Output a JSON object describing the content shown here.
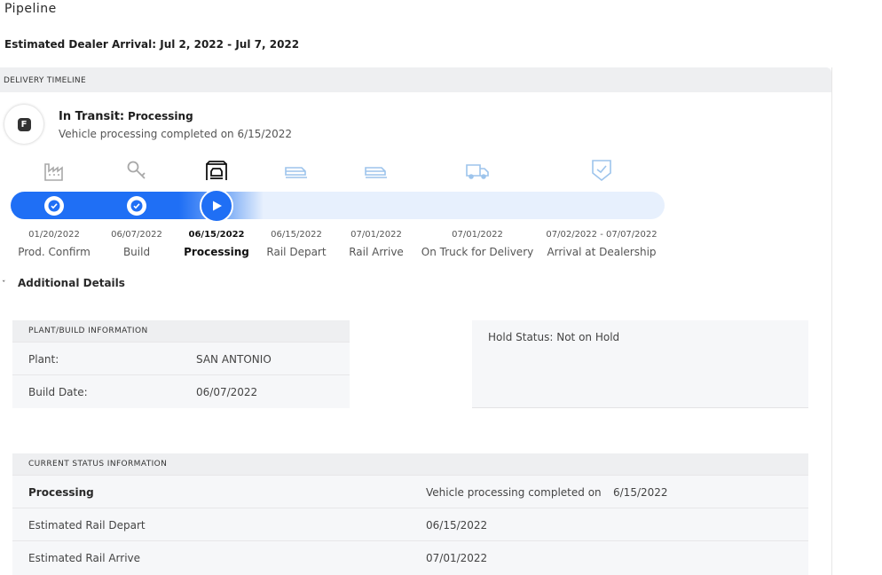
{
  "page": {
    "title": "Pipeline",
    "arrival": "Estimated Dealer Arrival: Jul 2, 2022 - Jul 7, 2022"
  },
  "timeline": {
    "header": "DELIVERY TIMELINE",
    "status_badge": "F",
    "status_label": "In Transit:",
    "status_value": "Processing",
    "status_sub": "Vehicle processing completed on 6/15/2022",
    "colors": {
      "active": "#1f6ff5",
      "upcoming": "#e7f0fd",
      "upcoming_icon": "#9dc4ec",
      "complete_icon": "#a0a0a0"
    },
    "steps": [
      {
        "date": "01/20/2022",
        "label": "Prod. Confirm",
        "icon": "factory-icon",
        "state": "complete"
      },
      {
        "date": "06/07/2022",
        "label": "Build",
        "icon": "wrench-icon",
        "state": "complete"
      },
      {
        "date": "06/15/2022",
        "label": "Processing",
        "icon": "vehicle-processing-icon",
        "state": "current"
      },
      {
        "date": "06/15/2022",
        "label": "Rail Depart",
        "icon": "rail-depart-icon",
        "state": "upcoming"
      },
      {
        "date": "07/01/2022",
        "label": "Rail Arrive",
        "icon": "rail-arrive-icon",
        "state": "upcoming"
      },
      {
        "date": "07/01/2022",
        "label": "On Truck for Delivery",
        "icon": "truck-icon",
        "state": "upcoming"
      },
      {
        "date": "07/02/2022 - 07/07/2022",
        "label": "Arrival at Dealership",
        "icon": "shield-check-icon",
        "state": "upcoming"
      }
    ]
  },
  "details": {
    "toggle_label": "Additional Details",
    "plant_info": {
      "header": "PLANT/BUILD INFORMATION",
      "rows": [
        {
          "label": "Plant:",
          "value": "SAN ANTONIO"
        },
        {
          "label": "Build Date:",
          "value": "06/07/2022"
        }
      ]
    },
    "hold": {
      "text": "Hold Status: Not on Hold"
    },
    "current_status": {
      "header": "CURRENT STATUS INFORMATION",
      "rows": [
        {
          "label": "Processing",
          "value": "Vehicle processing completed on",
          "extra": "6/15/2022"
        },
        {
          "label": "Estimated Rail Depart",
          "value": "06/15/2022",
          "extra": ""
        },
        {
          "label": "Estimated Rail Arrive",
          "value": "07/01/2022",
          "extra": ""
        }
      ]
    }
  }
}
